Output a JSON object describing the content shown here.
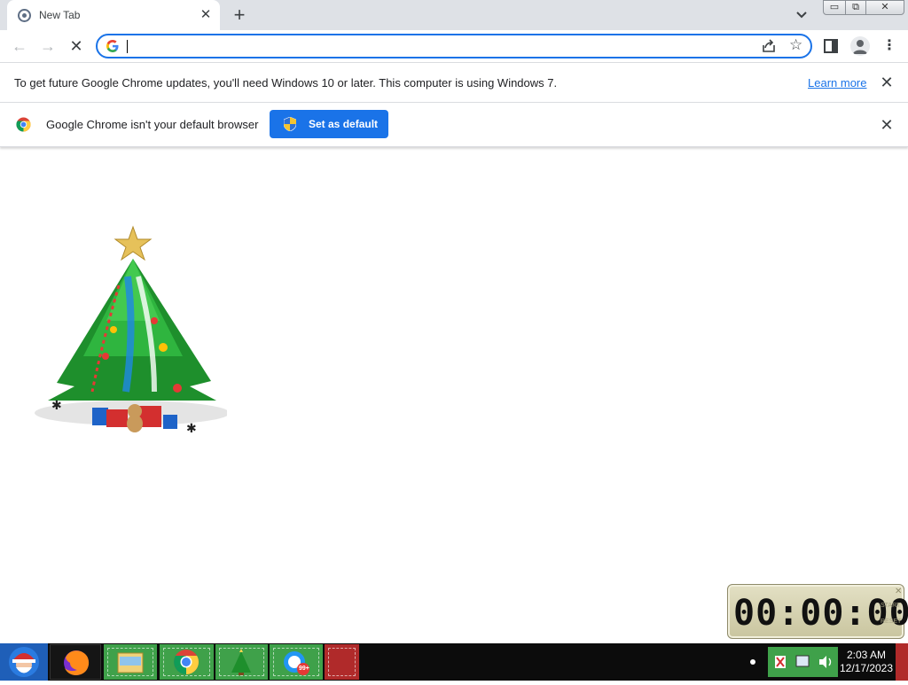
{
  "tab": {
    "title": "New Tab",
    "close": "✕",
    "new_tab": "+"
  },
  "window_controls": {
    "minimize": "▭",
    "maximize": "⧉",
    "close": "✕"
  },
  "toolbar": {
    "back": "←",
    "forward": "→",
    "stop": "✕",
    "omnibox_value": "",
    "star": "☆",
    "menu": "⋮"
  },
  "infobar_update": {
    "message": "To get future Google Chrome updates, you'll need Windows 10 or later. This computer is using Windows 7.",
    "link": "Learn more",
    "close": "✕"
  },
  "infobar_default": {
    "message": "Google Chrome isn't your default browser",
    "button": "Set as default",
    "close": "✕"
  },
  "timer": {
    "display": "00:00:00",
    "start": "START",
    "reset": "RESET",
    "close": "✕"
  },
  "taskbar": {
    "items": [
      "Santa start",
      "Firefox",
      "Windows Explorer",
      "Google Chrome",
      "Christmas tree",
      "Messenger"
    ],
    "messenger_badge": "99+",
    "clock_time": "2:03 AM",
    "clock_date": "12/17/2023"
  },
  "colors": {
    "accent": "#1a73e8",
    "taskbar_green": "#3fa14a",
    "taskbar_red": "#b02a2a"
  }
}
